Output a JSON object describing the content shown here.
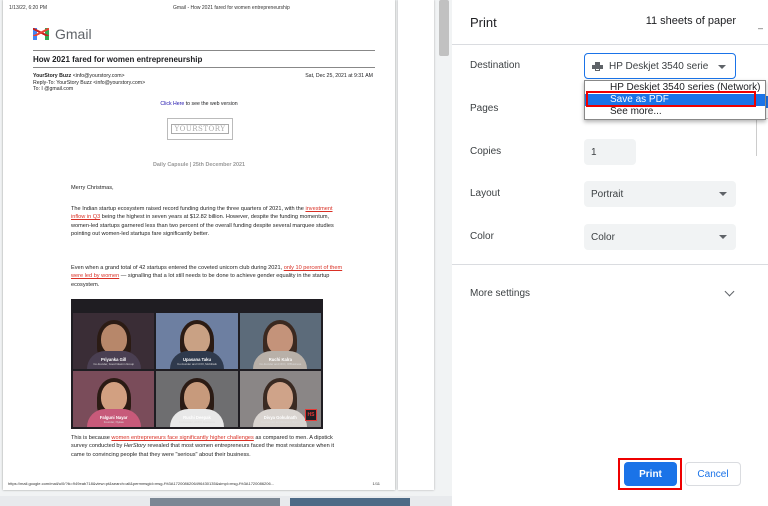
{
  "preview": {
    "header_datetime": "1/13/22, 6:20 PM",
    "header_title": "Gmail - How 2021 fared for women entrepreneurship",
    "gmail_label": "Gmail",
    "mail_title": "How 2021 fared for women entrepreneurship",
    "from_name": "YourStory Buzz",
    "from_email": "<info@yourstory.com>",
    "reply_to": "Reply-To: YourStory Buzz <info@yourstory.com>",
    "to": "To: I                @gmail.com",
    "date": "Sat, Dec 25, 2021 at 9:31 AM",
    "web_link": "Click Here",
    "web_text": " to see the web version",
    "logo_text": "YOURSTORY",
    "capsule": "Daily Capsule | 25th December 2021",
    "greeting": "Merry Christmas,",
    "p1_a": "The Indian startup ecosystem raised record funding during the three quarters of 2021, with the ",
    "p1_link": "investment inflow in Q3",
    "p1_b": " being the highest in seven years at $12.82 billion. However, despite the funding momentum, women-led startups garnered less than two percent of the overall funding despite several marquee studies pointing out women-led startups fare significantly better.",
    "p2_a": "Even when a grand total of 42 startups entered the coveted unicorn club during 2021, ",
    "p2_link": "only 10 percent of them were led by women",
    "p2_b": " — signalling that a lot still needs to be done to achieve gender equality in the startup ecosystem.",
    "people": [
      {
        "name": "Priyanka Gill",
        "role": "Co-founder, Good Glamm Group"
      },
      {
        "name": "Upasana Taku",
        "role": "Co-founder and COO, Mobikwik"
      },
      {
        "name": "Ruchi Kalra",
        "role": "Co-founder and CFO, OfBusiness"
      },
      {
        "name": "Falguni Nayar",
        "role": "Founder, Nykaa"
      },
      {
        "name": "Ruchi Deepak",
        "role": "Co-founder, ACKO Insurance"
      },
      {
        "name": "Divya Gokulnath",
        "role": "Co-founder and Director, Byju's"
      }
    ],
    "hs_badge": "HS",
    "p3_a": "This is because ",
    "p3_link": "women entrepreneurs face significantly higher challenges",
    "p3_b": " as compared to men. A dipstick survey conducted by ",
    "p3_italic": "HerStory",
    "p3_c": " revealed that most women entrepreneurs faced the most resistance when it came to convincing people that they were \"serious\" about their business.",
    "footer_url": "https://mail.google.com/mail/u/0/?ik=949eab718&view=pt&search=all&permmsgid=msg-f%3A1720086206496430135&simpl=msg-f%3A1720086206...",
    "footer_page": "1/11"
  },
  "panel": {
    "title": "Print",
    "sheets": "11 sheets of paper",
    "destination_label": "Destination",
    "destination_value": "HP Deskjet 3540 serie",
    "pages_label": "Pages",
    "copies_label": "Copies",
    "copies_value": "1",
    "layout_label": "Layout",
    "layout_value": "Portrait",
    "color_label": "Color",
    "color_value": "Color",
    "more_settings": "More settings",
    "print_button": "Print",
    "cancel_button": "Cancel",
    "cut_text": "–"
  },
  "dropdown": {
    "items": [
      "HP Deskjet 3540 series (Network)",
      "Save as PDF",
      "See more..."
    ],
    "selected": 1
  },
  "colors": {
    "accent": "#1a73e8",
    "highlight_box": "#ee0000",
    "link_red": "#d93025"
  }
}
